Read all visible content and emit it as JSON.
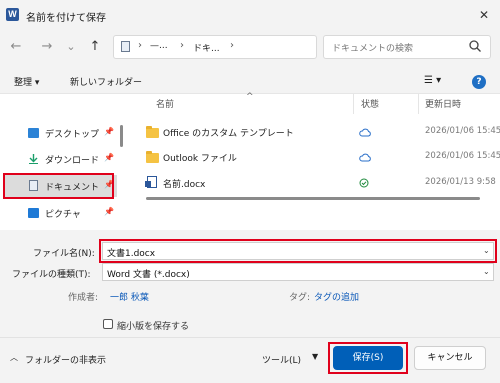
{
  "window": {
    "title": "名前を付けて保存",
    "app_icon": "W",
    "close": "✕"
  },
  "nav": {
    "back": "←",
    "forward": "→",
    "recent": "⌄",
    "up": "↑",
    "breadcrumb": [
      "—...",
      "ドキ...",
      "›"
    ],
    "search_placeholder": "ドキュメントの検索"
  },
  "toolbar": {
    "organize": "整理 ▾",
    "new_folder": "新しいフォルダー",
    "view": "☰ ▾",
    "help": "?"
  },
  "sidebar": {
    "items": [
      {
        "label": "デスクトップ",
        "icon": "desktop-icon"
      },
      {
        "label": "ダウンロード",
        "icon": "download-icon"
      },
      {
        "label": "ドキュメント",
        "icon": "documents-icon",
        "selected": true
      },
      {
        "label": "ピクチャ",
        "icon": "pictures-icon"
      }
    ]
  },
  "filelist": {
    "columns": {
      "name": "名前",
      "status": "状態",
      "date": "更新日時"
    },
    "rows": [
      {
        "name": "Office のカスタム テンプレート",
        "type": "folder",
        "status": "cloud",
        "date": "2026/01/06 15:45"
      },
      {
        "name": "Outlook ファイル",
        "type": "folder",
        "status": "cloud",
        "date": "2026/01/06 15:45"
      },
      {
        "name": "名前.docx",
        "type": "docx",
        "status": "synced",
        "date": "2026/01/13 9:58"
      }
    ]
  },
  "form": {
    "filename_label": "ファイル名(N):",
    "filename_value": "文書1.docx",
    "filetype_label": "ファイルの種類(T):",
    "filetype_value": "Word 文書 (*.docx)",
    "author_label": "作成者:",
    "author_value": "一郎 秋葉",
    "tags_label": "タグ:",
    "tags_value": "タグの追加",
    "thumbnail_label": "縮小版を保存する"
  },
  "footer": {
    "hide_folders": "フォルダーの非表示",
    "tools": "ツール(L)",
    "save": "保存(S)",
    "cancel": "キャンセル"
  },
  "colors": {
    "highlight": "#e0001b",
    "accent": "#005fb8",
    "link": "#0a58b8"
  }
}
